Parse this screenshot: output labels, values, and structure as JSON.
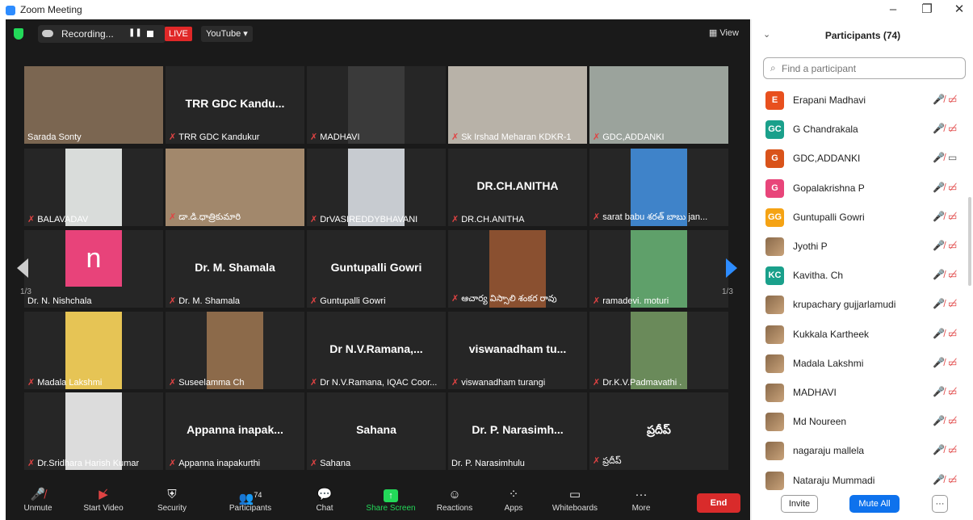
{
  "window": {
    "title": "Zoom Meeting",
    "minimize": "–",
    "restore": "❐",
    "close": "✕"
  },
  "topbar": {
    "recording": "Recording...",
    "live": "LIVE",
    "stream": "YouTube ▾",
    "view": "View"
  },
  "pages": {
    "left": "1/3",
    "right": "1/3"
  },
  "tiles": [
    {
      "label": "Sarada Sonty",
      "big": "",
      "muted": false,
      "active": true,
      "photo": "#7b6651"
    },
    {
      "label": "TRR GDC Kandukur",
      "big": "TRR GDC Kandu...",
      "muted": true
    },
    {
      "label": "MADHAVI",
      "big": "",
      "muted": true,
      "photo": "#3a3a3a"
    },
    {
      "label": "Sk Irshad Meharan KDKR-1",
      "big": "",
      "muted": true,
      "photo": "#b8b2a8"
    },
    {
      "label": "GDC,ADDANKI",
      "big": "",
      "muted": true,
      "photo": "#9ba39c"
    },
    {
      "label": "BALAVADAV",
      "big": "",
      "muted": true,
      "photo": "#d9dcda"
    },
    {
      "label": "డా.డి.ధాత్రికుమారి",
      "big": "",
      "muted": true,
      "photo": "#a2886c"
    },
    {
      "label": "DrVASIREDDYBHAVANI",
      "big": "",
      "muted": true,
      "photo": "#c7cbd0"
    },
    {
      "label": "DR.CH.ANITHA",
      "big": "DR.CH.ANITHA",
      "muted": true
    },
    {
      "label": "sarat babu శరత్ బాబు jan...",
      "big": "",
      "muted": true,
      "photo": "#3f83c9"
    },
    {
      "label": "Dr. N. Nishchala",
      "big": "",
      "muted": false,
      "letter": "n"
    },
    {
      "label": "Dr. M. Shamala",
      "big": "Dr. M. Shamala",
      "muted": true
    },
    {
      "label": "Guntupalli Gowri",
      "big": "Guntupalli Gowri",
      "muted": true
    },
    {
      "label": "ఆచార్య విస్సాలి శంకర రావు",
      "big": "",
      "muted": true,
      "photo": "#8a5030"
    },
    {
      "label": "ramadevi. moturi",
      "big": "",
      "muted": true,
      "photo": "#5fa06a"
    },
    {
      "label": "Madala Lakshmi",
      "big": "",
      "muted": true,
      "photo": "#e6c455"
    },
    {
      "label": "Suseelamma Ch",
      "big": "",
      "muted": true,
      "photo": "#8c6a4a"
    },
    {
      "label": "Dr N.V.Ramana, IQAC Coor...",
      "big": "Dr  N.V.Ramana,...",
      "muted": true
    },
    {
      "label": "viswanadham turangi",
      "big": "viswanadham  tu...",
      "muted": true
    },
    {
      "label": "Dr.K.V.Padmavathi .",
      "big": "",
      "muted": true,
      "photo": "#6a8a5a"
    },
    {
      "label": "Dr.Sridhara Harish Kumar",
      "big": "",
      "muted": true,
      "photo": "#dcdcdc"
    },
    {
      "label": "Appanna inapakurthi",
      "big": "Appanna  inapak...",
      "muted": true
    },
    {
      "label": "Sahana",
      "big": "Sahana",
      "muted": true
    },
    {
      "label": "Dr. P. Narasimhulu",
      "big": "Dr.  P.  Narasimh...",
      "muted": false
    },
    {
      "label": "ప్రదీప్",
      "big": "ప్రదీప్",
      "muted": true
    }
  ],
  "toolbar": {
    "unmute": "Unmute",
    "start_video": "Start Video",
    "security": "Security",
    "participants": "Participants",
    "participants_count": "74",
    "chat": "Chat",
    "share": "Share Screen",
    "reactions": "Reactions",
    "apps": "Apps",
    "whiteboards": "Whiteboards",
    "more": "More",
    "end": "End"
  },
  "panel": {
    "title": "Participants (74)",
    "search_placeholder": "Find a participant",
    "invite": "Invite",
    "mute_all": "Mute All",
    "more": "···",
    "participants": [
      {
        "name": "Erapani Madhavi",
        "initials": "E",
        "color": "#e8501e",
        "video": false
      },
      {
        "name": "G Chandrakala",
        "initials": "GC",
        "color": "#1aa08b",
        "video": false
      },
      {
        "name": "GDC,ADDANKI",
        "initials": "G",
        "color": "#d9531a",
        "video": true
      },
      {
        "name": "Gopalakrishna P",
        "initials": "G",
        "color": "#e8457a",
        "video": false
      },
      {
        "name": "Guntupalli Gowri",
        "initials": "GG",
        "color": "#f5a314",
        "video": false
      },
      {
        "name": "Jyothi P",
        "initials": "",
        "color": "",
        "video": false
      },
      {
        "name": "Kavitha. Ch",
        "initials": "KC",
        "color": "#1aa08b",
        "video": false
      },
      {
        "name": "krupachary gujjarlamudi",
        "initials": "",
        "color": "",
        "video": false
      },
      {
        "name": "Kukkala Kartheek",
        "initials": "",
        "color": "",
        "video": false
      },
      {
        "name": "Madala Lakshmi",
        "initials": "",
        "color": "",
        "video": false
      },
      {
        "name": "MADHAVI",
        "initials": "",
        "color": "",
        "video": false
      },
      {
        "name": "Md Noureen",
        "initials": "",
        "color": "",
        "video": false
      },
      {
        "name": "nagaraju mallela",
        "initials": "",
        "color": "",
        "video": false
      },
      {
        "name": "Nataraju Mummadi",
        "initials": "",
        "color": "",
        "video": false
      }
    ]
  },
  "icons": {
    "mic_off": "mic-off-icon",
    "video_off": "video-off-icon"
  }
}
